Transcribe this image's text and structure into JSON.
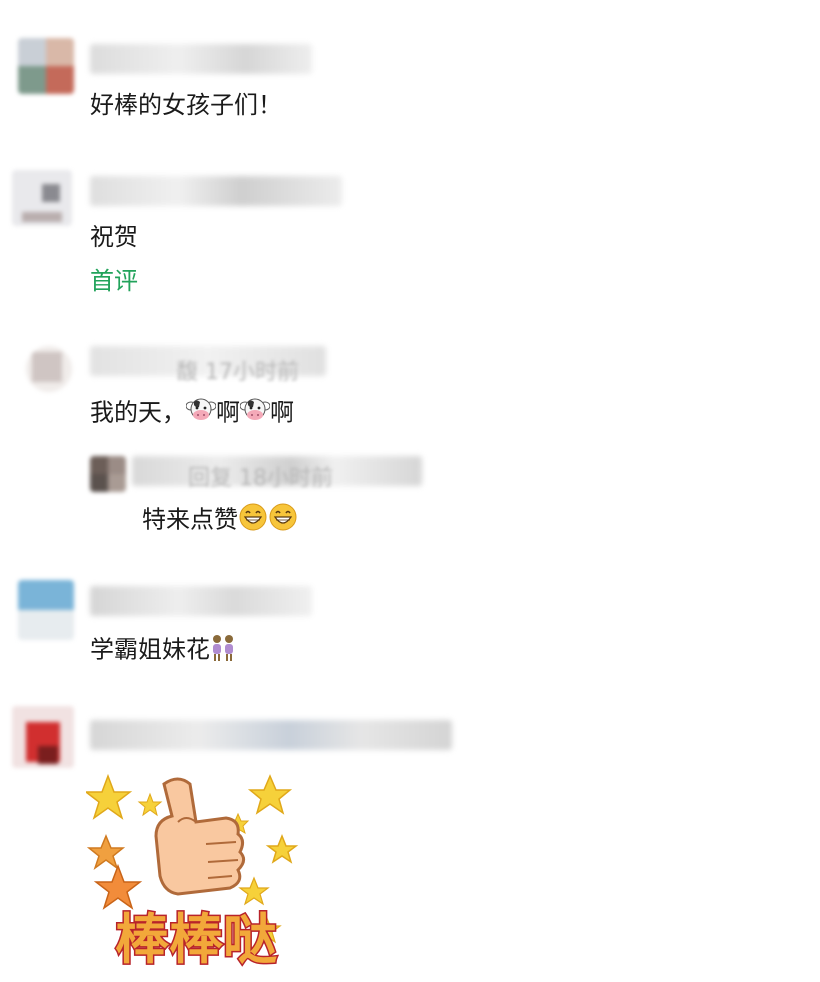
{
  "comments": [
    {
      "text": "好棒的女孩子们！"
    },
    {
      "text": "祝贺",
      "tag": "首评"
    },
    {
      "text_a": "我的天，",
      "text_b": "啊",
      "text_c": "啊",
      "emoji": "cow-face-icon",
      "meta_ghost": "馥  17小时前",
      "reply": {
        "text": "特来点赞",
        "emoji": "grinning-face-icon",
        "meta_ghost": "回复  18小时前"
      }
    },
    {
      "text": "学霸姐妹花",
      "emoji": "two-women-icon"
    },
    {
      "sticker_text": "棒棒哒"
    }
  ],
  "colors": {
    "tag": "#22a35b",
    "text": "#1a1a1a",
    "meta": "#b8b8b8"
  }
}
